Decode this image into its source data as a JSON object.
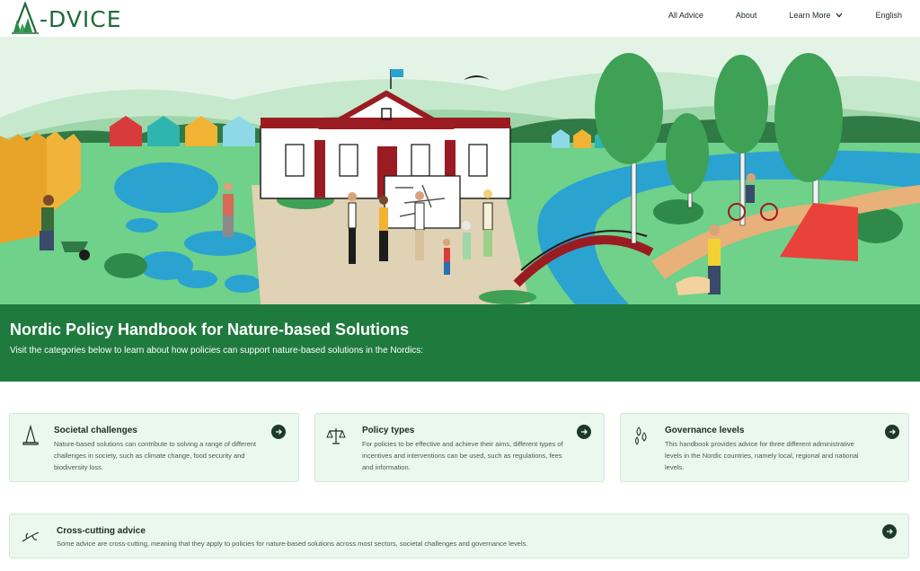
{
  "header": {
    "logo_text": "-DVICE",
    "nav": [
      {
        "label": "All Advice"
      },
      {
        "label": "About"
      },
      {
        "label": "Learn More"
      },
      {
        "label": "English"
      }
    ]
  },
  "banner": {
    "title": "Nordic Policy Handbook for Nature-based Solutions",
    "subtitle": "Visit the categories below to learn about how policies can support nature-based solutions in the Nordics:"
  },
  "cards": [
    {
      "icon": "traffic-cone-icon",
      "title": "Societal challenges",
      "description": "Nature-based solutions can contribute to solving a range of different challenges in society, such as climate change, food security and biodiversity loss."
    },
    {
      "icon": "scales-icon",
      "title": "Policy types",
      "description": "For policies to be effective and achieve their aims, different types of incentives and interventions can be used, such as regulations, fees and information."
    },
    {
      "icon": "leaves-icon",
      "title": "Governance levels",
      "description": "This handbook provides advice for three different administrative levels in the Nordic countries, namely local, regional and national levels."
    }
  ],
  "cross_card": {
    "icon": "branch-icon",
    "title": "Cross-cutting advice",
    "description": "Some advice are cross-cutting, meaning that they apply to policies for nature-based solutions across most sectors, societal challenges and governance levels."
  },
  "colors": {
    "brand_green": "#1f7a3e",
    "card_bg": "#eaf8ee",
    "arrow_bg": "#1d3a28"
  }
}
